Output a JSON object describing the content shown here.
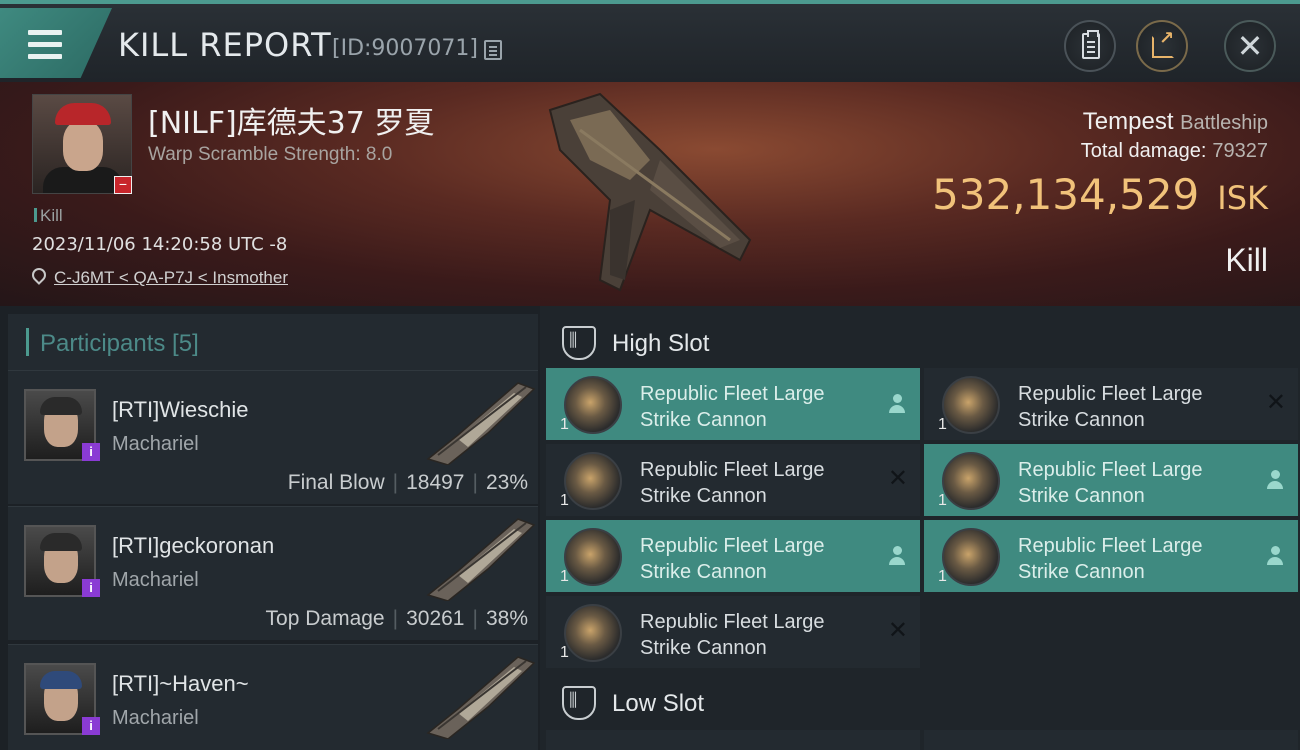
{
  "header": {
    "title": "KILL REPORT",
    "report_id": "[ID:9007071]"
  },
  "victim": {
    "name": "[NILF]库德夫37 罗夏",
    "scramble": "Warp Scramble Strength: 8.0",
    "tag": "Kill",
    "datetime": "2023/11/06 14:20:58 UTC -8",
    "location": "C-J6MT < QA-P7J < Insmother",
    "ship": "Tempest",
    "ship_class": "Battleship",
    "total_damage_label": "Total damage:",
    "total_damage": "79327",
    "isk_value": "532,134,529",
    "isk_unit": "ISK",
    "result": "Kill"
  },
  "participants": {
    "header": "Participants [5]",
    "items": [
      {
        "name": "[RTI]Wieschie",
        "ship": "Machariel",
        "role": "Final Blow",
        "damage": "18497",
        "percent": "23%"
      },
      {
        "name": "[RTI]geckoronan",
        "ship": "Machariel",
        "role": "Top Damage",
        "damage": "30261",
        "percent": "38%"
      },
      {
        "name": "[RTI]~Haven~",
        "ship": "Machariel",
        "role": "",
        "damage": "",
        "percent": ""
      }
    ]
  },
  "fitting": {
    "high_slot_title": "High Slot",
    "low_slot_title": "Low Slot",
    "high_slot": [
      {
        "name": "Republic Fleet Large Strike Cannon",
        "qty": "1",
        "state": "dropped"
      },
      {
        "name": "Republic Fleet Large Strike Cannon",
        "qty": "1",
        "state": "destroyed"
      },
      {
        "name": "Republic Fleet Large Strike Cannon",
        "qty": "1",
        "state": "destroyed"
      },
      {
        "name": "Republic Fleet Large Strike Cannon",
        "qty": "1",
        "state": "dropped"
      },
      {
        "name": "Republic Fleet Large Strike Cannon",
        "qty": "1",
        "state": "dropped"
      },
      {
        "name": "Republic Fleet Large Strike Cannon",
        "qty": "1",
        "state": "dropped"
      },
      {
        "name": "Republic Fleet Large Strike Cannon",
        "qty": "1",
        "state": "destroyed"
      }
    ]
  },
  "colors": {
    "accent": "#3f8a80",
    "isk": "#f1c27a",
    "badge_purple": "#8a3bd4",
    "badge_red": "#c8252b"
  }
}
